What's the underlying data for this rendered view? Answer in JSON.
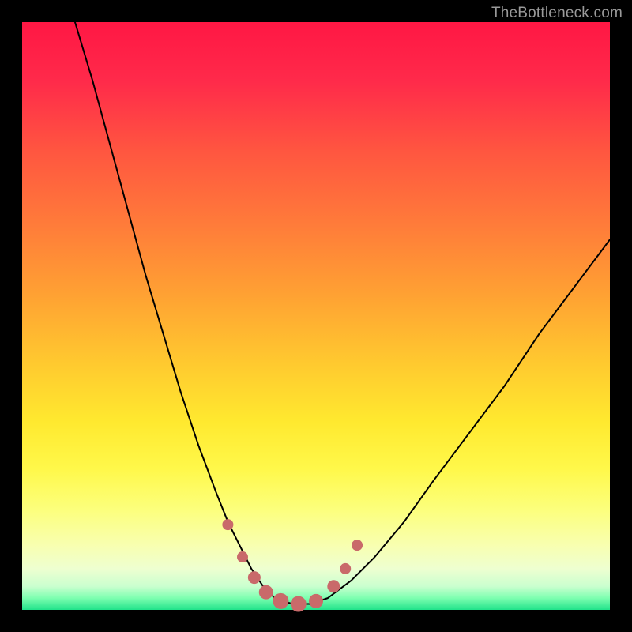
{
  "watermark": "TheBottleneck.com",
  "chart_data": {
    "type": "line",
    "title": "",
    "xlabel": "",
    "ylabel": "",
    "xlim": [
      0,
      100
    ],
    "ylim": [
      0,
      100
    ],
    "grid": false,
    "series": [
      {
        "name": "bottleneck-curve",
        "x": [
          9,
          12,
          15,
          18,
          21,
          24,
          27,
          30,
          33,
          35,
          37,
          39,
          41,
          43,
          46,
          49,
          52,
          56,
          60,
          65,
          70,
          76,
          82,
          88,
          94,
          100
        ],
        "y": [
          100,
          90,
          79,
          68,
          57,
          47,
          37,
          28,
          20,
          15,
          11,
          7,
          4,
          2,
          1,
          1,
          2,
          5,
          9,
          15,
          22,
          30,
          38,
          47,
          55,
          63
        ],
        "stroke": "#000000",
        "stroke_width": 2
      }
    ],
    "markers": [
      {
        "x": 35.0,
        "y": 14.5,
        "r": 7,
        "fill": "#c96a6a"
      },
      {
        "x": 37.5,
        "y": 9.0,
        "r": 7,
        "fill": "#c96a6a"
      },
      {
        "x": 39.5,
        "y": 5.5,
        "r": 8,
        "fill": "#c96a6a"
      },
      {
        "x": 41.5,
        "y": 3.0,
        "r": 9,
        "fill": "#c96a6a"
      },
      {
        "x": 44.0,
        "y": 1.5,
        "r": 10,
        "fill": "#c96a6a"
      },
      {
        "x": 47.0,
        "y": 1.0,
        "r": 10,
        "fill": "#c96a6a"
      },
      {
        "x": 50.0,
        "y": 1.5,
        "r": 9,
        "fill": "#c96a6a"
      },
      {
        "x": 53.0,
        "y": 4.0,
        "r": 8,
        "fill": "#c96a6a"
      },
      {
        "x": 55.0,
        "y": 7.0,
        "r": 7,
        "fill": "#c96a6a"
      },
      {
        "x": 57.0,
        "y": 11.0,
        "r": 7,
        "fill": "#c96a6a"
      }
    ]
  }
}
